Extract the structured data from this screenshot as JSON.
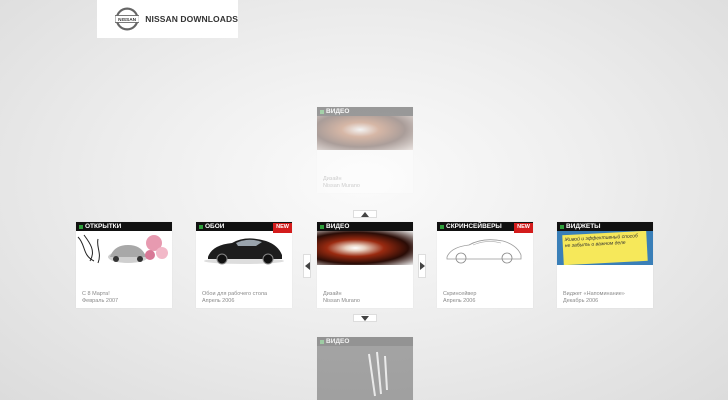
{
  "brand": {
    "title": "NISSAN DOWNLOADS",
    "badge_text": "NISSAN"
  },
  "cards": {
    "top": {
      "category": "ВИДЕО",
      "caption1": "Дизайн",
      "caption2": "Nissan Murano"
    },
    "bottom": {
      "category": "ВИДЕО"
    },
    "row": [
      {
        "category": "ОТКРЫТКИ",
        "caption1": "С 8 Марта!",
        "caption2": "Февраль 2007"
      },
      {
        "category": "ОБОИ",
        "new": "NEW",
        "caption1": "Обои для рабочего стола",
        "caption2": "Апрель 2006"
      },
      {
        "category": "ВИДЕО",
        "caption1": "Дизайн",
        "caption2": "Nissan Murano"
      },
      {
        "category": "СКРИНСЕЙВЕРЫ",
        "new": "NEW",
        "caption1": "Скринсейвер",
        "caption2": "Апрель 2006"
      },
      {
        "category": "ВИДЖЕТЫ",
        "caption1": "Виджет «Напоминание»",
        "caption2": "Декабрь 2006"
      }
    ]
  },
  "widget_note": "Живой и эффективный способ не забыть о важном деле",
  "colors": {
    "accent_green": "#2e9e3a",
    "new_red": "#d41c1c",
    "header_black": "#111111"
  },
  "icons": {
    "up": "chevron-up-icon",
    "down": "chevron-down-icon",
    "left": "chevron-left-icon",
    "right": "chevron-right-icon"
  }
}
